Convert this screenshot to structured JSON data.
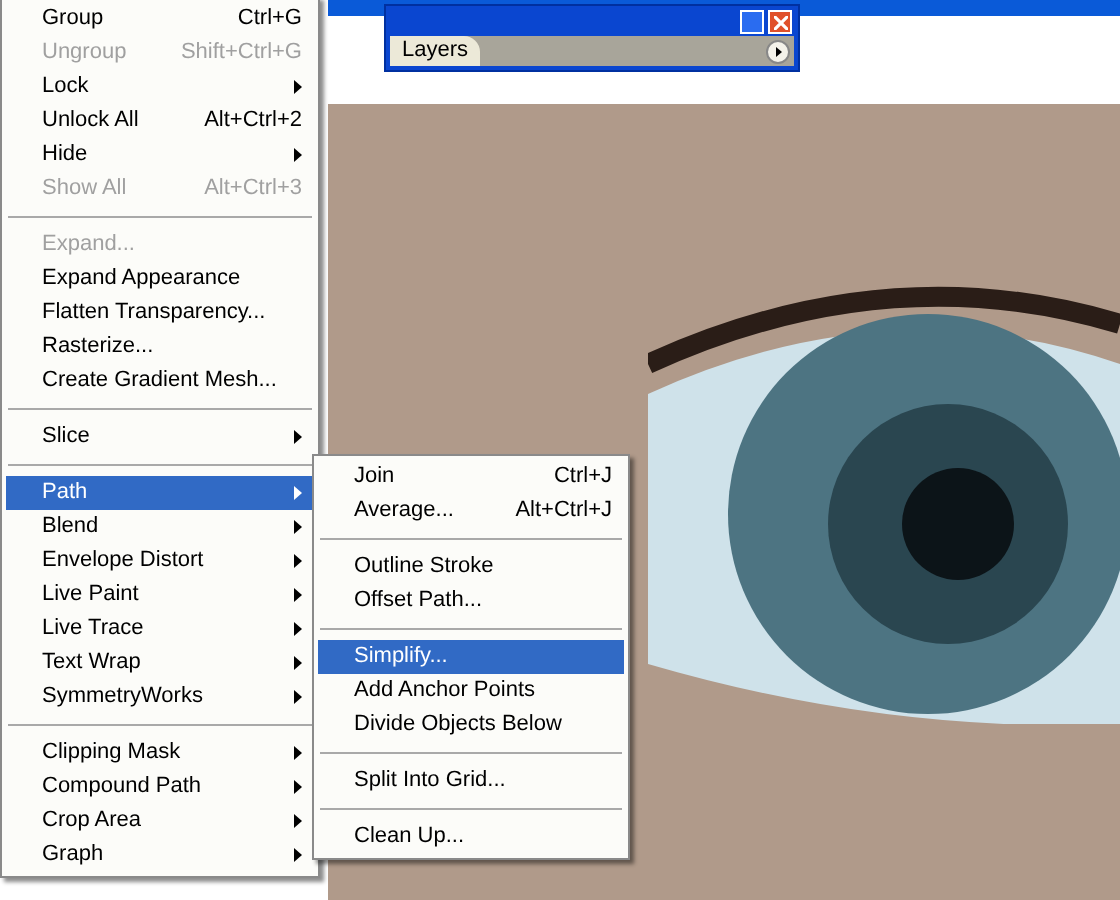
{
  "layers_panel": {
    "tab": "Layers"
  },
  "menu": {
    "groups": [
      [
        {
          "label": "Group",
          "shortcut": "Ctrl+G",
          "has_submenu": false,
          "disabled": false,
          "selected": false
        },
        {
          "label": "Ungroup",
          "shortcut": "Shift+Ctrl+G",
          "has_submenu": false,
          "disabled": true,
          "selected": false
        },
        {
          "label": "Lock",
          "has_submenu": true,
          "disabled": false,
          "selected": false
        },
        {
          "label": "Unlock All",
          "shortcut": "Alt+Ctrl+2",
          "has_submenu": false,
          "disabled": false,
          "selected": false
        },
        {
          "label": "Hide",
          "has_submenu": true,
          "disabled": false,
          "selected": false
        },
        {
          "label": "Show All",
          "shortcut": "Alt+Ctrl+3",
          "has_submenu": false,
          "disabled": true,
          "selected": false
        }
      ],
      [
        {
          "label": "Expand...",
          "has_submenu": false,
          "disabled": true,
          "selected": false
        },
        {
          "label": "Expand Appearance",
          "has_submenu": false,
          "disabled": false,
          "selected": false
        },
        {
          "label": "Flatten Transparency...",
          "has_submenu": false,
          "disabled": false,
          "selected": false
        },
        {
          "label": "Rasterize...",
          "has_submenu": false,
          "disabled": false,
          "selected": false
        },
        {
          "label": "Create Gradient Mesh...",
          "has_submenu": false,
          "disabled": false,
          "selected": false
        }
      ],
      [
        {
          "label": "Slice",
          "has_submenu": true,
          "disabled": false,
          "selected": false
        }
      ],
      [
        {
          "label": "Path",
          "has_submenu": true,
          "disabled": false,
          "selected": true
        },
        {
          "label": "Blend",
          "has_submenu": true,
          "disabled": false,
          "selected": false
        },
        {
          "label": "Envelope Distort",
          "has_submenu": true,
          "disabled": false,
          "selected": false
        },
        {
          "label": "Live Paint",
          "has_submenu": true,
          "disabled": false,
          "selected": false
        },
        {
          "label": "Live Trace",
          "has_submenu": true,
          "disabled": false,
          "selected": false
        },
        {
          "label": "Text Wrap",
          "has_submenu": true,
          "disabled": false,
          "selected": false
        },
        {
          "label": "SymmetryWorks",
          "has_submenu": true,
          "disabled": false,
          "selected": false
        }
      ],
      [
        {
          "label": "Clipping Mask",
          "has_submenu": true,
          "disabled": false,
          "selected": false
        },
        {
          "label": "Compound Path",
          "has_submenu": true,
          "disabled": false,
          "selected": false
        },
        {
          "label": "Crop Area",
          "has_submenu": true,
          "disabled": false,
          "selected": false
        },
        {
          "label": "Graph",
          "has_submenu": true,
          "disabled": false,
          "selected": false
        }
      ]
    ]
  },
  "submenu": {
    "groups": [
      [
        {
          "label": "Join",
          "shortcut": "Ctrl+J",
          "has_submenu": false,
          "disabled": false,
          "selected": false
        },
        {
          "label": "Average...",
          "shortcut": "Alt+Ctrl+J",
          "has_submenu": false,
          "disabled": false,
          "selected": false
        }
      ],
      [
        {
          "label": "Outline Stroke",
          "has_submenu": false,
          "disabled": false,
          "selected": false
        },
        {
          "label": "Offset Path...",
          "has_submenu": false,
          "disabled": false,
          "selected": false
        }
      ],
      [
        {
          "label": "Simplify...",
          "has_submenu": false,
          "disabled": false,
          "selected": true
        },
        {
          "label": "Add Anchor Points",
          "has_submenu": false,
          "disabled": false,
          "selected": false
        },
        {
          "label": "Divide Objects Below",
          "has_submenu": false,
          "disabled": false,
          "selected": false
        }
      ],
      [
        {
          "label": "Split Into Grid...",
          "has_submenu": false,
          "disabled": false,
          "selected": false
        }
      ],
      [
        {
          "label": "Clean Up...",
          "has_submenu": false,
          "disabled": false,
          "selected": false
        }
      ]
    ]
  }
}
